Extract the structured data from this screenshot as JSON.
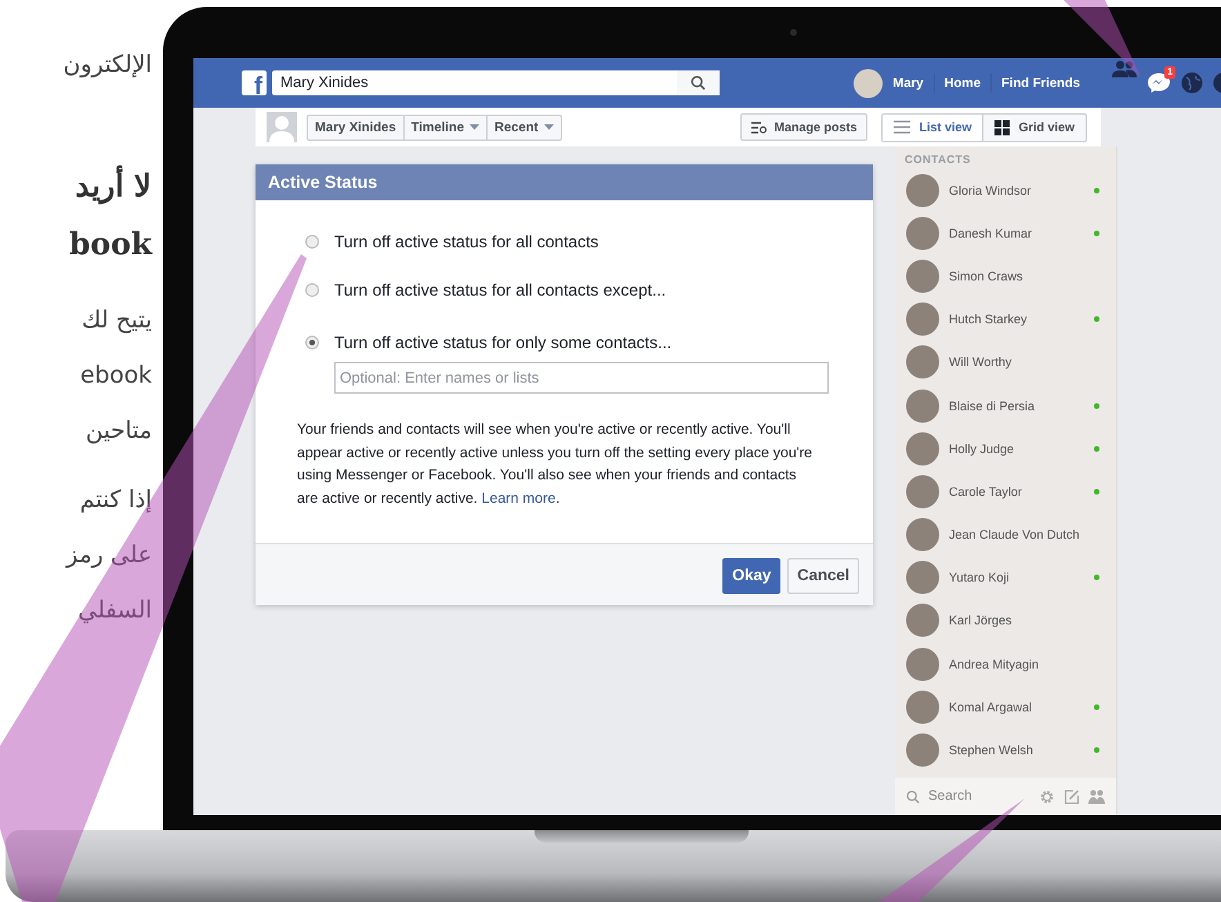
{
  "article": {
    "partial_line": "الإلكترون",
    "heading": [
      "لا أريد",
      "book"
    ],
    "paragraphs": [
      [
        "يتيح لك",
        "ebook",
        "متاحين"
      ],
      [
        "إذا كنتم",
        "على رمز",
        "السفلي"
      ]
    ]
  },
  "topbar": {
    "logo": "f",
    "search_value": "Mary Xinides",
    "user": "Mary",
    "nav": [
      "Home",
      "Find Friends"
    ],
    "badge": "1"
  },
  "timeline_bar": {
    "name": "Mary Xinides",
    "dropdowns": [
      "Timeline",
      "Recent"
    ],
    "manage": "Manage posts",
    "views": [
      {
        "label": "List view",
        "kind": "list",
        "selected": true
      },
      {
        "label": "Grid view",
        "kind": "grid",
        "selected": false
      }
    ]
  },
  "dialog": {
    "title": "Active Status",
    "options": [
      {
        "label": "Turn off active status for all contacts",
        "selected": false
      },
      {
        "label": "Turn off active status for all contacts except...",
        "selected": false
      },
      {
        "label": "Turn off active status for only some contacts...",
        "selected": true
      }
    ],
    "placeholder": "Optional: Enter names or lists",
    "description": "Your friends and contacts will see when you're active or recently active. You'll appear active or recently active unless you turn off the setting every place you're using Messenger or Facebook. You'll also see when your friends and contacts are active or recently active.",
    "link": "Learn more",
    "link_after": ".",
    "buttons": [
      {
        "label": "Okay",
        "kind": "primary"
      },
      {
        "label": "Cancel",
        "kind": "secondary"
      }
    ]
  },
  "sidebar": {
    "heading": "CONTACTS",
    "contacts": [
      {
        "name": "Gloria Windsor",
        "online": true
      },
      {
        "name": "Danesh Kumar",
        "online": true
      },
      {
        "name": "Simon Craws",
        "online": false
      },
      {
        "name": "Hutch Starkey",
        "online": true
      },
      {
        "name": "Will Worthy",
        "online": false
      },
      {
        "name": "Blaise di Persia",
        "online": true
      },
      {
        "name": "Holly Judge",
        "online": true
      },
      {
        "name": "Carole Taylor",
        "online": true
      },
      {
        "name": "Jean Claude Von Dutch",
        "online": false
      },
      {
        "name": "Yutaro Koji",
        "online": true
      },
      {
        "name": "Karl Jörges",
        "online": false
      },
      {
        "name": "Andrea Mityagin",
        "online": false
      },
      {
        "name": "Komal Argawal",
        "online": true
      },
      {
        "name": "Stephen Welsh",
        "online": true
      }
    ],
    "search_placeholder": "Search"
  }
}
